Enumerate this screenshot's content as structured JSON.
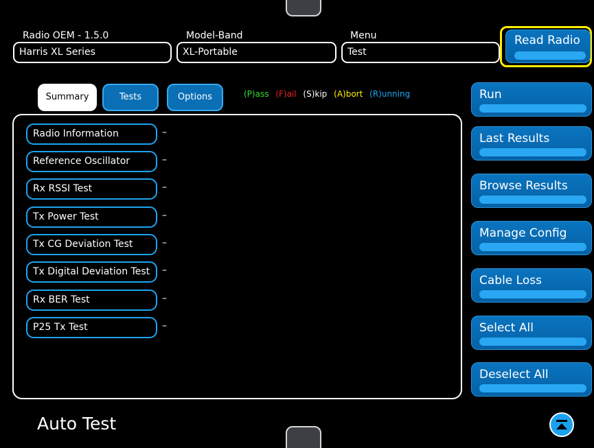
{
  "header": {
    "fields": [
      {
        "label": "Radio OEM - 1.5.0",
        "value": "Harris XL Series"
      },
      {
        "label": "Model-Band",
        "value": "XL-Portable"
      },
      {
        "label": "Menu",
        "value": "Test"
      }
    ],
    "read_radio_label": "Read Radio"
  },
  "tabs": [
    {
      "label": "Summary",
      "active": true
    },
    {
      "label": "Tests",
      "active": false
    },
    {
      "label": "Options",
      "active": false
    }
  ],
  "legend": [
    {
      "text": "(P)ass",
      "color": "#33dd33"
    },
    {
      "text": "(F)ail",
      "color": "#ee2222"
    },
    {
      "text": "(S)kip",
      "color": "#ffffff"
    },
    {
      "text": "(A)bort",
      "color": "#ffee00"
    },
    {
      "text": "(R)unning",
      "color": "#1ea5f0"
    }
  ],
  "tests": [
    {
      "name": "Radio Information",
      "result": "–"
    },
    {
      "name": "Reference Oscillator",
      "result": "–"
    },
    {
      "name": "Rx RSSI Test",
      "result": "–"
    },
    {
      "name": "Tx Power Test",
      "result": "–"
    },
    {
      "name": "Tx CG Deviation Test",
      "result": "–"
    },
    {
      "name": "Tx Digital Deviation Test",
      "result": "–"
    },
    {
      "name": "Rx BER Test",
      "result": "–"
    },
    {
      "name": "P25 Tx Test",
      "result": "–"
    }
  ],
  "side_buttons": [
    {
      "label": "Run"
    },
    {
      "label": "Last Results"
    },
    {
      "label": "Browse Results"
    },
    {
      "label": "Manage Config"
    },
    {
      "label": "Cable Loss"
    },
    {
      "label": "Select All"
    },
    {
      "label": "Deselect All"
    }
  ],
  "footer": {
    "title": "Auto Test",
    "collapse_icon": "chevron-up-circle-icon"
  },
  "colors": {
    "accent_blue": "#0a74bf",
    "highlight": "#ffee00",
    "background": "#000000"
  }
}
